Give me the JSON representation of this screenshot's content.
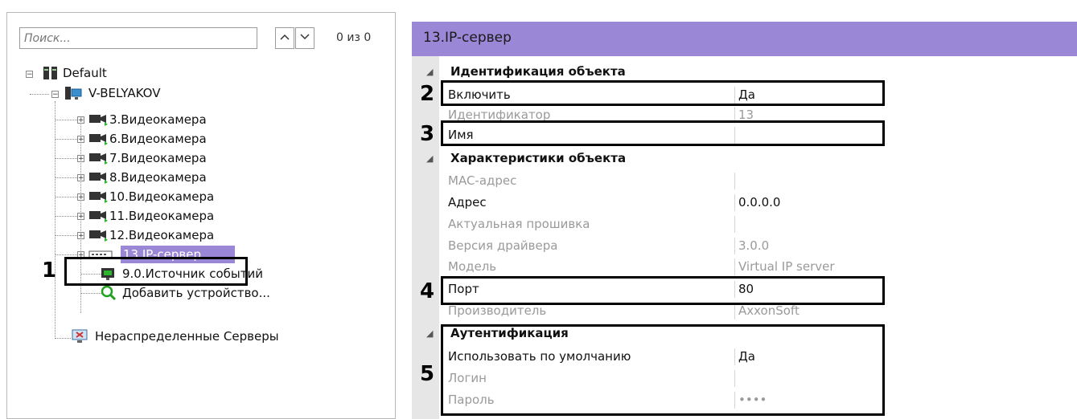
{
  "search": {
    "placeholder": "Поиск...",
    "count": "0 из 0",
    "up_icon": "chevron-up",
    "down_icon": "chevron-down"
  },
  "tree": {
    "root": "Default",
    "server": "V-BELYAKOV",
    "cameras": [
      "3.Видеокамера",
      "6.Видеокамера",
      "7.Видеокамера",
      "8.Видеокамера",
      "10.Видеокамера",
      "11.Видеокамера",
      "12.Видеокамера"
    ],
    "ip_server": "13.IP-сервер",
    "event_source": "9.0.Источник событий",
    "add_device": "Добавить устройство...",
    "unassigned": "Нераспределенные Серверы"
  },
  "properties": {
    "title": "13.IP-сервер",
    "cat_identification": "Идентификация объекта",
    "enable_label": "Включить",
    "enable_value": "Да",
    "id_label": "Идентификатор",
    "id_value": "13",
    "name_label": "Имя",
    "name_value": "",
    "cat_characteristics": "Характеристики объекта",
    "mac_label": "MAC-адрес",
    "mac_value": "",
    "address_label": "Адрес",
    "address_value": "0.0.0.0",
    "firmware_label": "Актуальная прошивка",
    "firmware_value": "",
    "driver_label": "Версия драйвера",
    "driver_value": "3.0.0",
    "model_label": "Модель",
    "model_value": "Virtual IP server",
    "port_label": "Порт",
    "port_value": "80",
    "vendor_label": "Производитель",
    "vendor_value": "AxxonSoft",
    "cat_auth": "Аутентификация",
    "default_label": "Использовать по умолчанию",
    "default_value": "Да",
    "login_label": "Логин",
    "login_value": "",
    "password_label": "Пароль",
    "password_value": "••••"
  },
  "callouts": [
    "1",
    "2",
    "3",
    "4",
    "5"
  ],
  "colors": {
    "header": "#9a87d6",
    "selection": "#9a87d6",
    "grid": "#e6e6e6"
  }
}
